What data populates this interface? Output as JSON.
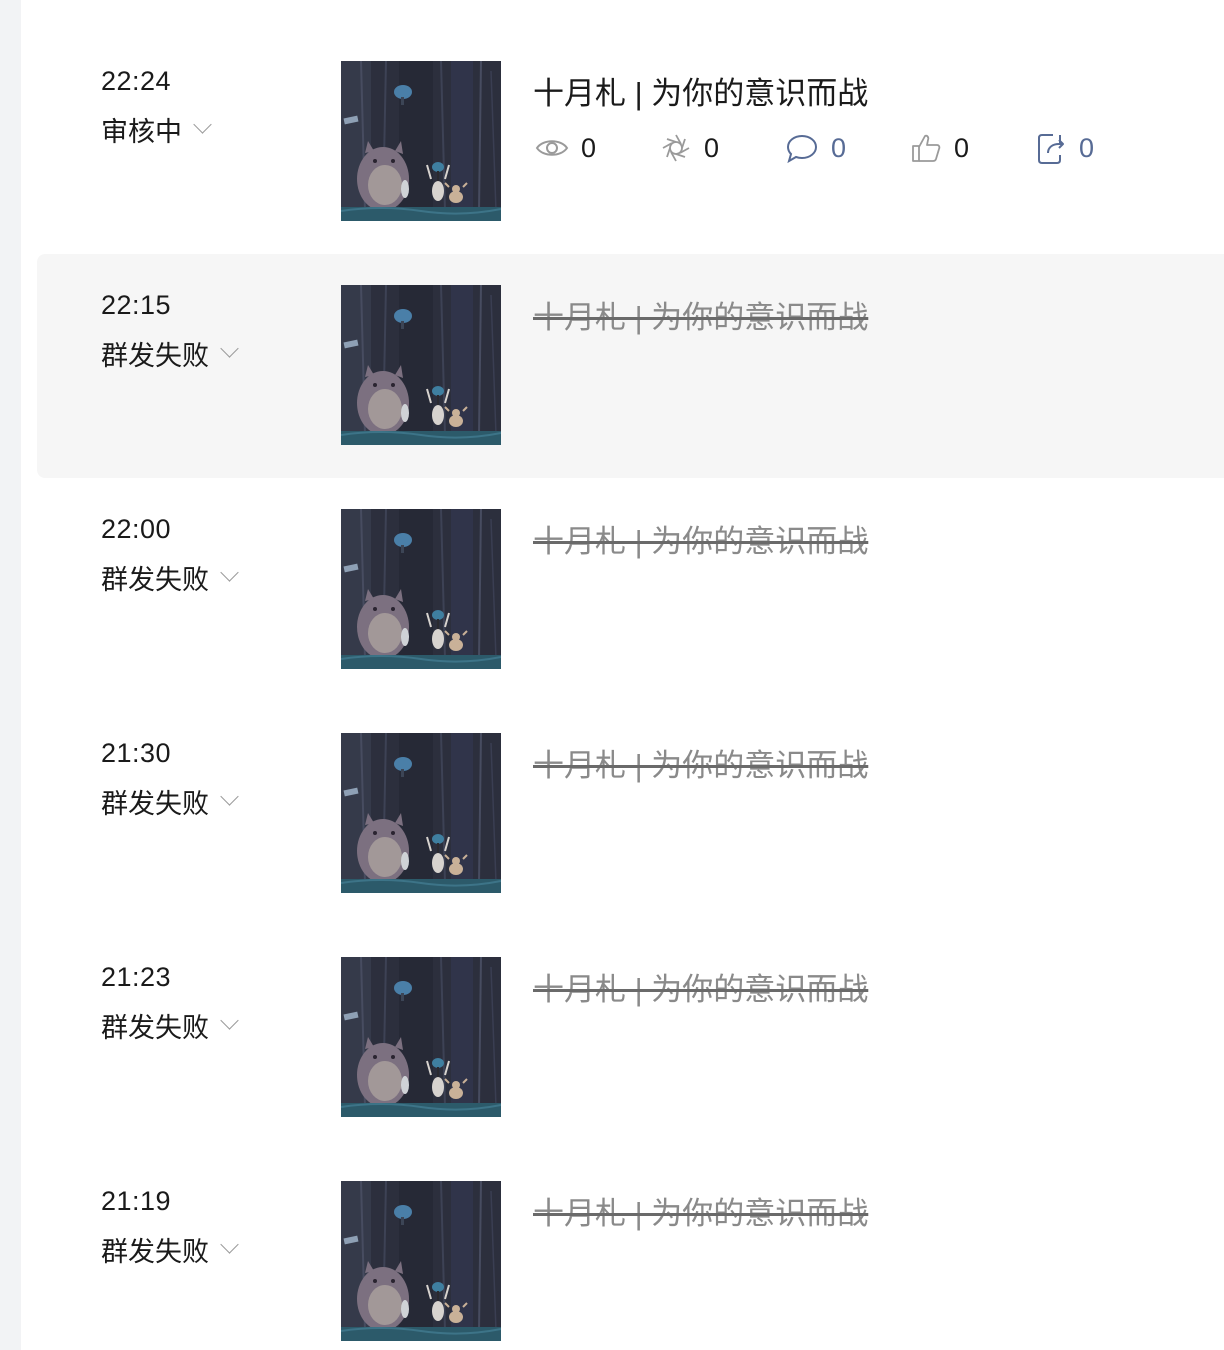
{
  "colors": {
    "text_primary": "#1a1a1a",
    "text_failed": "#8a8a8a",
    "link_blue": "#576b95",
    "icon_gray": "#9a9a9a",
    "hover_bg": "#f6f6f6"
  },
  "articles": [
    {
      "time": "22:24",
      "status": "审核中",
      "title": "十月札 | 为你的意识而战",
      "failed": false,
      "stats": {
        "views": "0",
        "shares_wechat": "0",
        "comments": "0",
        "likes": "0",
        "forwards": "0"
      }
    },
    {
      "time": "22:15",
      "status": "群发失败",
      "title": "十月札 | 为你的意识而战",
      "failed": true
    },
    {
      "time": "22:00",
      "status": "群发失败",
      "title": "十月札 | 为你的意识而战",
      "failed": true
    },
    {
      "time": "21:30",
      "status": "群发失败",
      "title": "十月札 | 为你的意识而战",
      "failed": true
    },
    {
      "time": "21:23",
      "status": "群发失败",
      "title": "十月札 | 为你的意识而战",
      "failed": true
    },
    {
      "time": "21:19",
      "status": "群发失败",
      "title": "十月札 | 为你的意识而战",
      "failed": true
    }
  ],
  "icons": {
    "views": "eye-icon",
    "shares_wechat": "moments-icon",
    "comments": "comment-icon",
    "likes": "thumbs-up-icon",
    "forwards": "forward-icon",
    "status_toggle": "chevron-down-icon",
    "thumbnail": "article-cover-image"
  }
}
